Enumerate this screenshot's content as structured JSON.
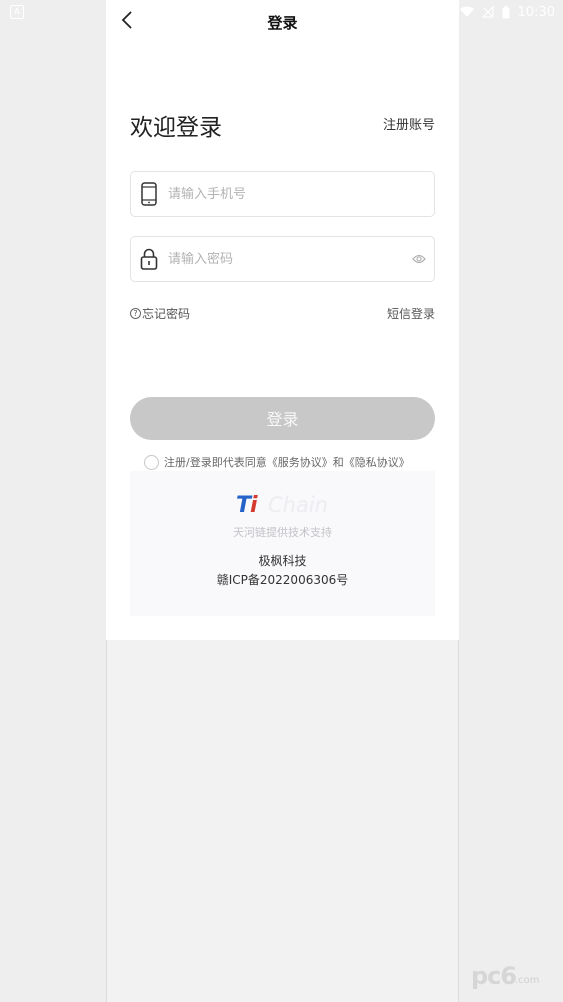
{
  "status_bar": {
    "time": "10:30",
    "left_icon": "A",
    "icons": [
      "wifi-icon",
      "signal-off-icon",
      "battery-icon"
    ]
  },
  "nav": {
    "title": "登录",
    "back_icon": "chevron-left-icon"
  },
  "form": {
    "welcome": "欢迎登录",
    "register_link": "注册账号",
    "phone": {
      "placeholder": "请输入手机号",
      "value": "",
      "icon": "mobile-phone-icon"
    },
    "password": {
      "placeholder": "请输入密码",
      "value": "",
      "icon": "lock-icon",
      "toggle_icon": "eye-icon"
    },
    "forgot": "忘记密码",
    "forgot_icon": "question-icon",
    "sms_login": "短信登录",
    "submit": "登录",
    "agreement": "注册/登录即代表同意《服务协议》和《隐私协议》"
  },
  "footer": {
    "logo_ti": "Ti",
    "logo_chain": "Chain",
    "support_text": "天河链提供技术支持",
    "company": "极枫科技",
    "icp": "赣ICP备2022006306号"
  },
  "watermark": {
    "text": "pc6",
    "suffix": ".com"
  },
  "colors": {
    "button_disabled": "#c8c8c8",
    "logo_blue": "#2563c9",
    "logo_red": "#d53a2e",
    "background": "#eeeeee"
  }
}
